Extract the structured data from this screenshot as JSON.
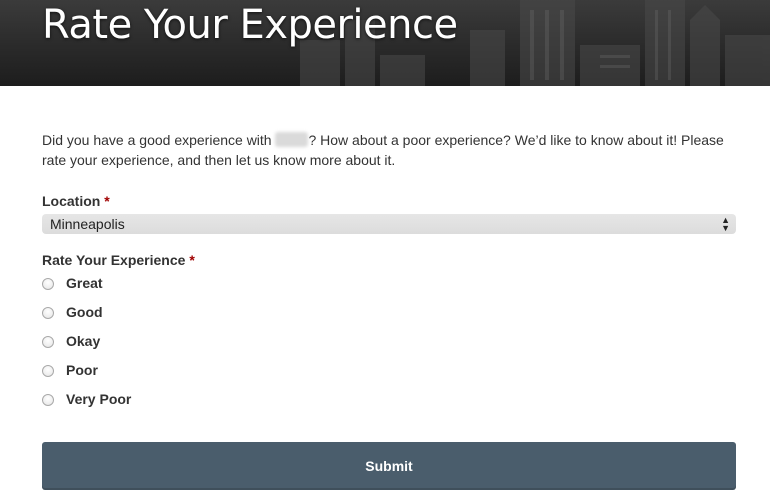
{
  "header": {
    "title": "Rate Your Experience"
  },
  "intro": {
    "before": "Did you have a good experience with ",
    "after": "? How about a poor experience? We’d like to know about it! Please rate your experience, and then let us know more about it."
  },
  "location": {
    "label": "Location",
    "required_mark": "*",
    "selected": "Minneapolis",
    "arrows_icon": "updown-arrows-icon"
  },
  "rating": {
    "label": "Rate Your Experience",
    "required_mark": "*",
    "options": [
      "Great",
      "Good",
      "Okay",
      "Poor",
      "Very Poor"
    ]
  },
  "submit": {
    "label": "Submit"
  },
  "colors": {
    "header_bg": "#2a2a2a",
    "button_bg": "#4a5d6c",
    "required": "#a00000"
  }
}
